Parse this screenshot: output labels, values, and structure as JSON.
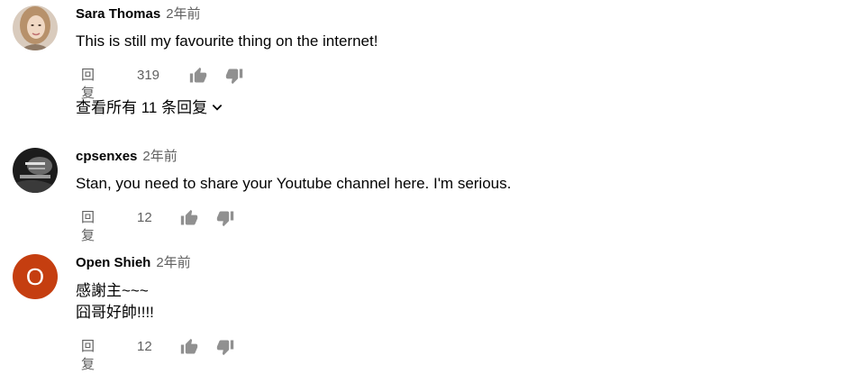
{
  "comments": [
    {
      "author": "Sara Thomas",
      "time": "2年前",
      "text_lines": [
        "This is still my favourite thing on the internet!"
      ],
      "reply_label": "回复",
      "likes": "319",
      "view_replies": "查看所有 11 条回复",
      "avatar": "photo"
    },
    {
      "author": "cpsenxes",
      "time": "2年前",
      "text_lines": [
        "Stan, you need to share your Youtube channel here. I'm serious."
      ],
      "reply_label": "回复",
      "likes": "12",
      "avatar": "photo"
    },
    {
      "author": "Open Shieh",
      "time": "2年前",
      "text_lines": [
        "感謝主~~~",
        "囧哥好帥!!!!"
      ],
      "reply_label": "回复",
      "likes": "12",
      "avatar": "letter",
      "avatar_letter": "O",
      "avatar_color": "#c53e10"
    }
  ],
  "icons": {
    "like": "thumbs-up-icon",
    "dislike": "thumbs-down-icon",
    "expand": "chevron-down-icon"
  },
  "colors": {
    "text": "#030303",
    "secondary": "#606060",
    "avatar_orange": "#c53e10"
  }
}
